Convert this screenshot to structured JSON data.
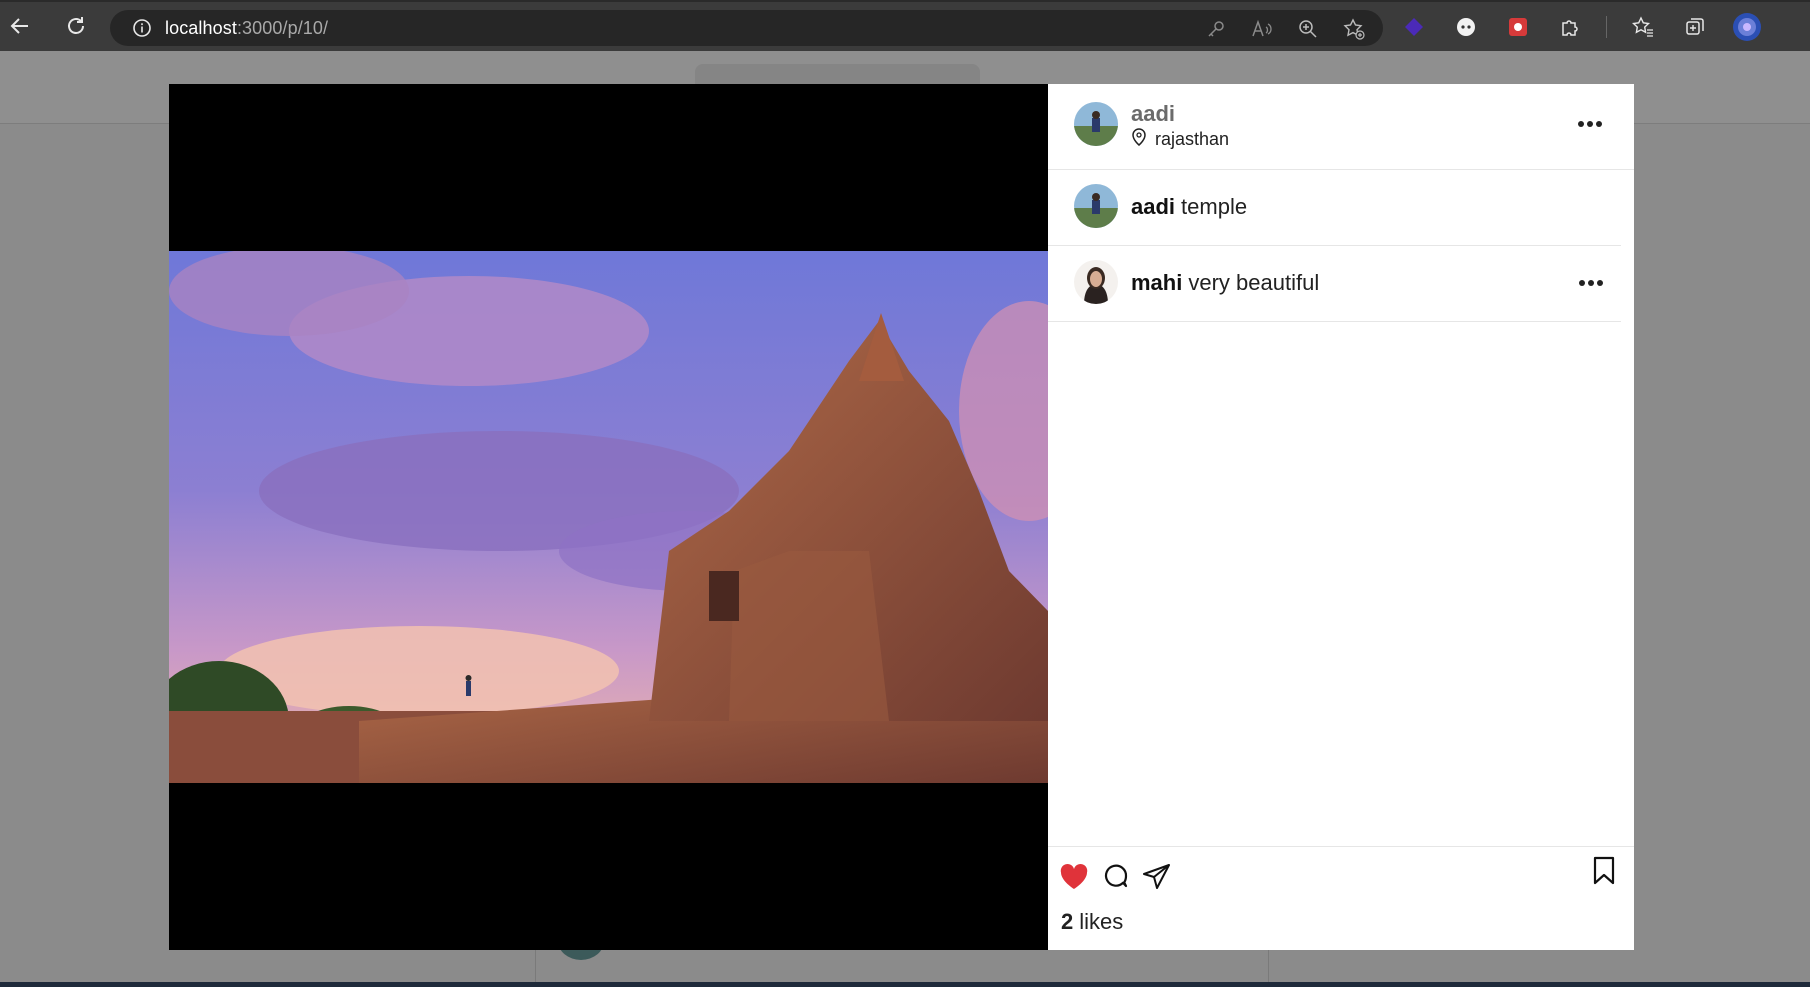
{
  "browser": {
    "url_host": "localhost",
    "url_path": ":3000/p/10/"
  },
  "post": {
    "author": "aadi",
    "location": "rajasthan",
    "caption_user": "aadi",
    "caption": "temple",
    "comments": [
      {
        "user": "mahi",
        "text": "very beautiful"
      }
    ],
    "likes_count": "2",
    "likes_label": "likes",
    "liked": true,
    "like_color": "#e0333a"
  },
  "icons": {
    "back": "back-arrow-icon",
    "refresh": "refresh-icon",
    "info": "info-icon",
    "more": "more-horizontal-icon",
    "location": "location-pin-icon",
    "like": "heart-icon",
    "comment": "comment-icon",
    "share": "share-send-icon",
    "save": "bookmark-icon"
  }
}
